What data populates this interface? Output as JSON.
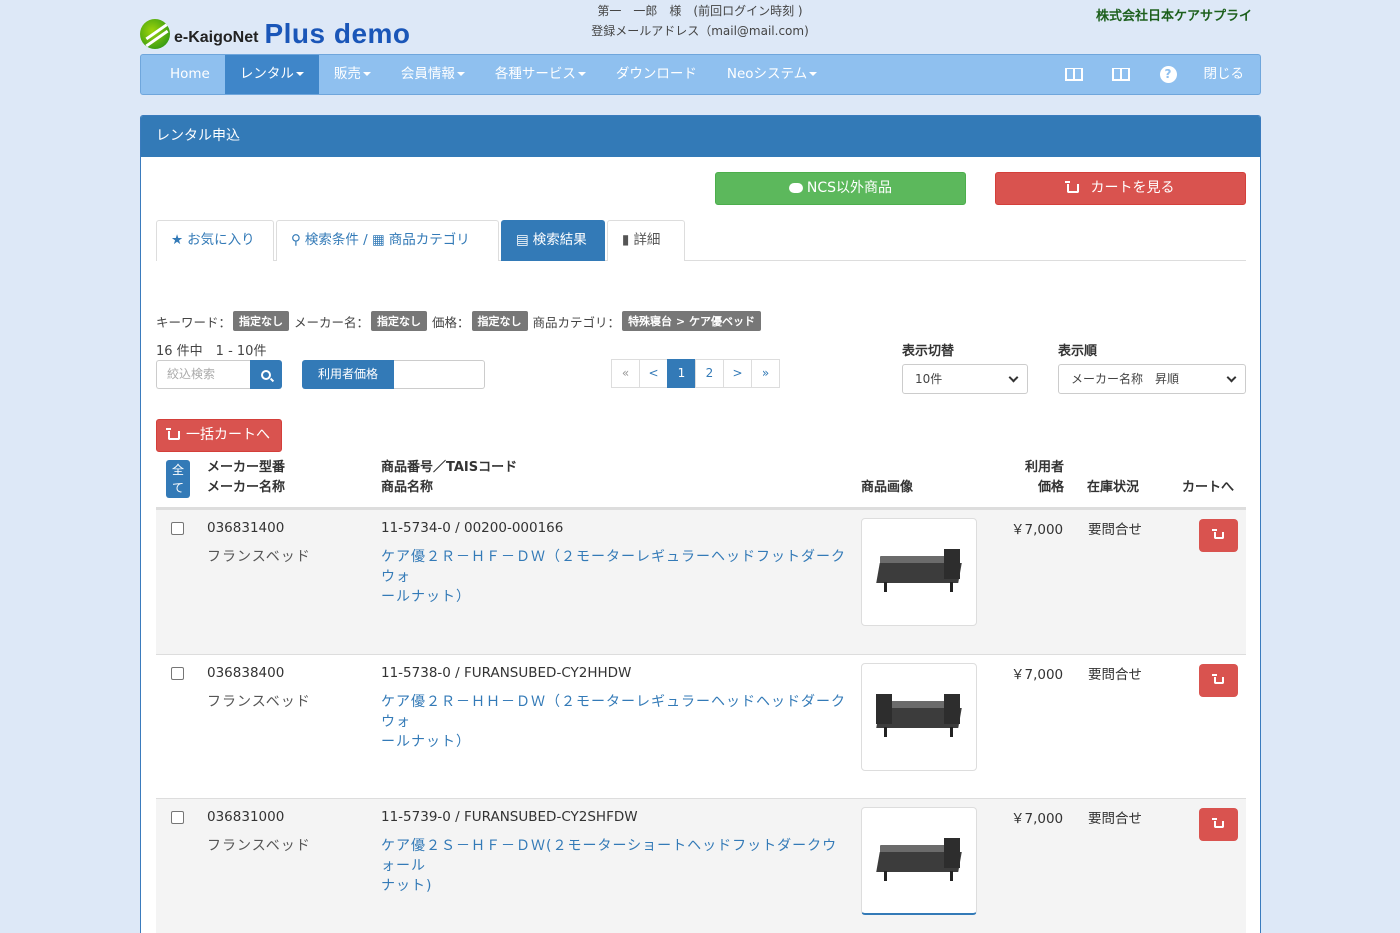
{
  "header": {
    "logo_small": "e-KaigoNet",
    "logo_large": "Plus demo",
    "user_line1": "第一　一郎　様　(前回ログイン時刻 )",
    "user_line2": "登録メールアドレス（mail@mail.com)",
    "company": "株式会社日本ケアサプライ"
  },
  "nav": {
    "items": [
      {
        "label": "Home"
      },
      {
        "label": "レンタル"
      },
      {
        "label": "販売"
      },
      {
        "label": "会員情報"
      },
      {
        "label": "各種サービス"
      },
      {
        "label": "ダウンロード"
      },
      {
        "label": "Neoシステム"
      }
    ],
    "help_glyph": "?",
    "close_label": "閉じる"
  },
  "panel": {
    "title": "レンタル申込",
    "ncs_button": "NCS以外商品",
    "cart_button": "カートを見る"
  },
  "tabs": [
    {
      "label": "お気に入り",
      "icon": "★"
    },
    {
      "label": "検索条件 / ",
      "label2": "商品カテゴリ"
    },
    {
      "label": "検索結果"
    },
    {
      "label": "詳細"
    }
  ],
  "filters": {
    "keyword_label": "キーワード：",
    "keyword_value": "指定なし",
    "maker_label": "メーカー名：",
    "maker_value": "指定なし",
    "price_label": "価格：",
    "price_value": "指定なし",
    "category_label": "商品カテゴリ：",
    "category_value": "特殊寝台 > ケア優ベッド"
  },
  "results": {
    "count_text": "16 件中　1 - 10件",
    "search_placeholder": "絞込検索",
    "price_toggle": "利用者価格"
  },
  "pager": {
    "first": "«",
    "prev": "<",
    "pages": [
      "1",
      "2"
    ],
    "next": ">",
    "last": "»"
  },
  "display": {
    "count_label": "表示切替",
    "count_value": "10件",
    "order_label": "表示順",
    "order_value": "メーカー名称　昇順"
  },
  "bulk_cart": "一括カートへ",
  "table": {
    "select_all_1": "全",
    "select_all_2": "て",
    "col_maker_1": "メーカー型番",
    "col_maker_2": "メーカー名称",
    "col_product_1": "商品番号／TAISコード",
    "col_product_2": "商品名称",
    "col_image": "商品画像",
    "col_price_1": "利用者",
    "col_price_2": "価格",
    "col_stock": "在庫状況",
    "col_cart": "カートへ",
    "rows": [
      {
        "model": "036831400",
        "maker": "フランスベッド",
        "code": "11-5734-0 / 00200-000166",
        "name_1": "ケア優２Ｒ－ＨＦ－ＤＷ（２モーターレギュラーヘッドフットダークウォ",
        "name_2": "ールナット）",
        "price": "￥7,000",
        "stock": "要問合せ"
      },
      {
        "model": "036838400",
        "maker": "フランスベッド",
        "code": "11-5738-0 / FURANSUBED-CY2HHDW",
        "name_1": "ケア優２Ｒ－ＨＨ－ＤＷ（２モーターレギュラーヘッドヘッドダークウォ",
        "name_2": "ールナット）",
        "price": "￥7,000",
        "stock": "要問合せ"
      },
      {
        "model": "036831000",
        "maker": "フランスベッド",
        "code": "11-5739-0 / FURANSUBED-CY2SHFDW",
        "name_1": "ケア優２Ｓ－ＨＦ－ＤＷ(２モーターショートヘッドフットダークウォール",
        "name_2": "ナット)",
        "price": "￥7,000",
        "stock": "要問合せ"
      }
    ]
  }
}
